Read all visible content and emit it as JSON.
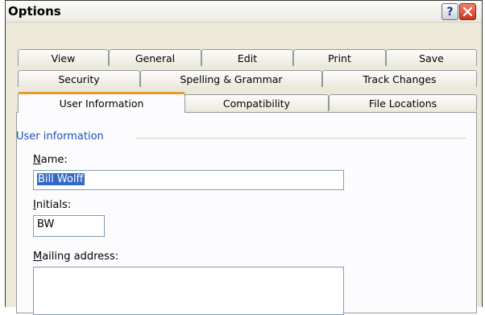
{
  "window": {
    "title": "Options",
    "help_glyph": "?",
    "close_icon": "close-icon"
  },
  "tabs": {
    "row1": [
      "View",
      "General",
      "Edit",
      "Print",
      "Save"
    ],
    "row2": [
      "Security",
      "Spelling & Grammar",
      "Track Changes"
    ],
    "row3": [
      "User Information",
      "Compatibility",
      "File Locations"
    ],
    "active": "User Information"
  },
  "user_info": {
    "group_label": "User information",
    "name_label_first": "N",
    "name_label_rest": "ame:",
    "name_value": "Bill Wolff",
    "initials_label_first": "I",
    "initials_label_rest": "nitials:",
    "initials_value": "BW",
    "mailing_label_first": "M",
    "mailing_label_rest": "ailing address:",
    "mailing_value": ""
  },
  "colors": {
    "accent_tab": "#e69b2a",
    "group_label": "#1f4fb8",
    "selection": "#3169c6",
    "close_button": "#c8361c"
  }
}
